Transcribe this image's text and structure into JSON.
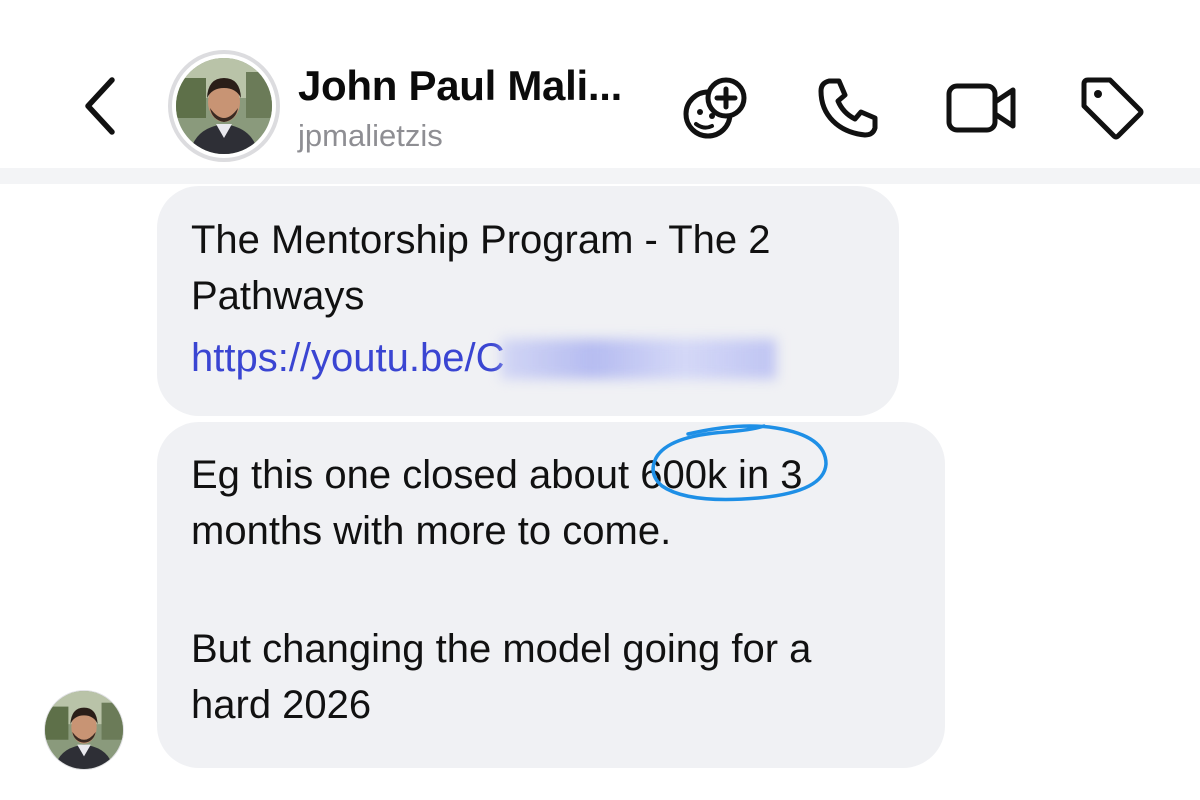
{
  "header": {
    "contact_name": "John Paul Mali...",
    "contact_handle": "jpmalietzis"
  },
  "icons": {
    "back": "chevron-left-icon",
    "sticker": "sticker-plus-icon",
    "phone": "phone-icon",
    "video": "video-camera-icon",
    "tag": "tag-icon"
  },
  "messages": [
    {
      "lines": [
        "The Mentorship Program - The 2",
        "Pathways"
      ],
      "link_visible": "https://youtu.be/C"
    },
    {
      "lines": [
        "Eg this one closed about 600k in 3",
        "months with more to come.",
        "But changing the model going for a",
        "hard 2026"
      ]
    }
  ],
  "colors": {
    "link": "#3a45d2",
    "bubble": "#f0f1f4",
    "annotation": "#1e8fe6",
    "handle": "#8e8e93"
  }
}
